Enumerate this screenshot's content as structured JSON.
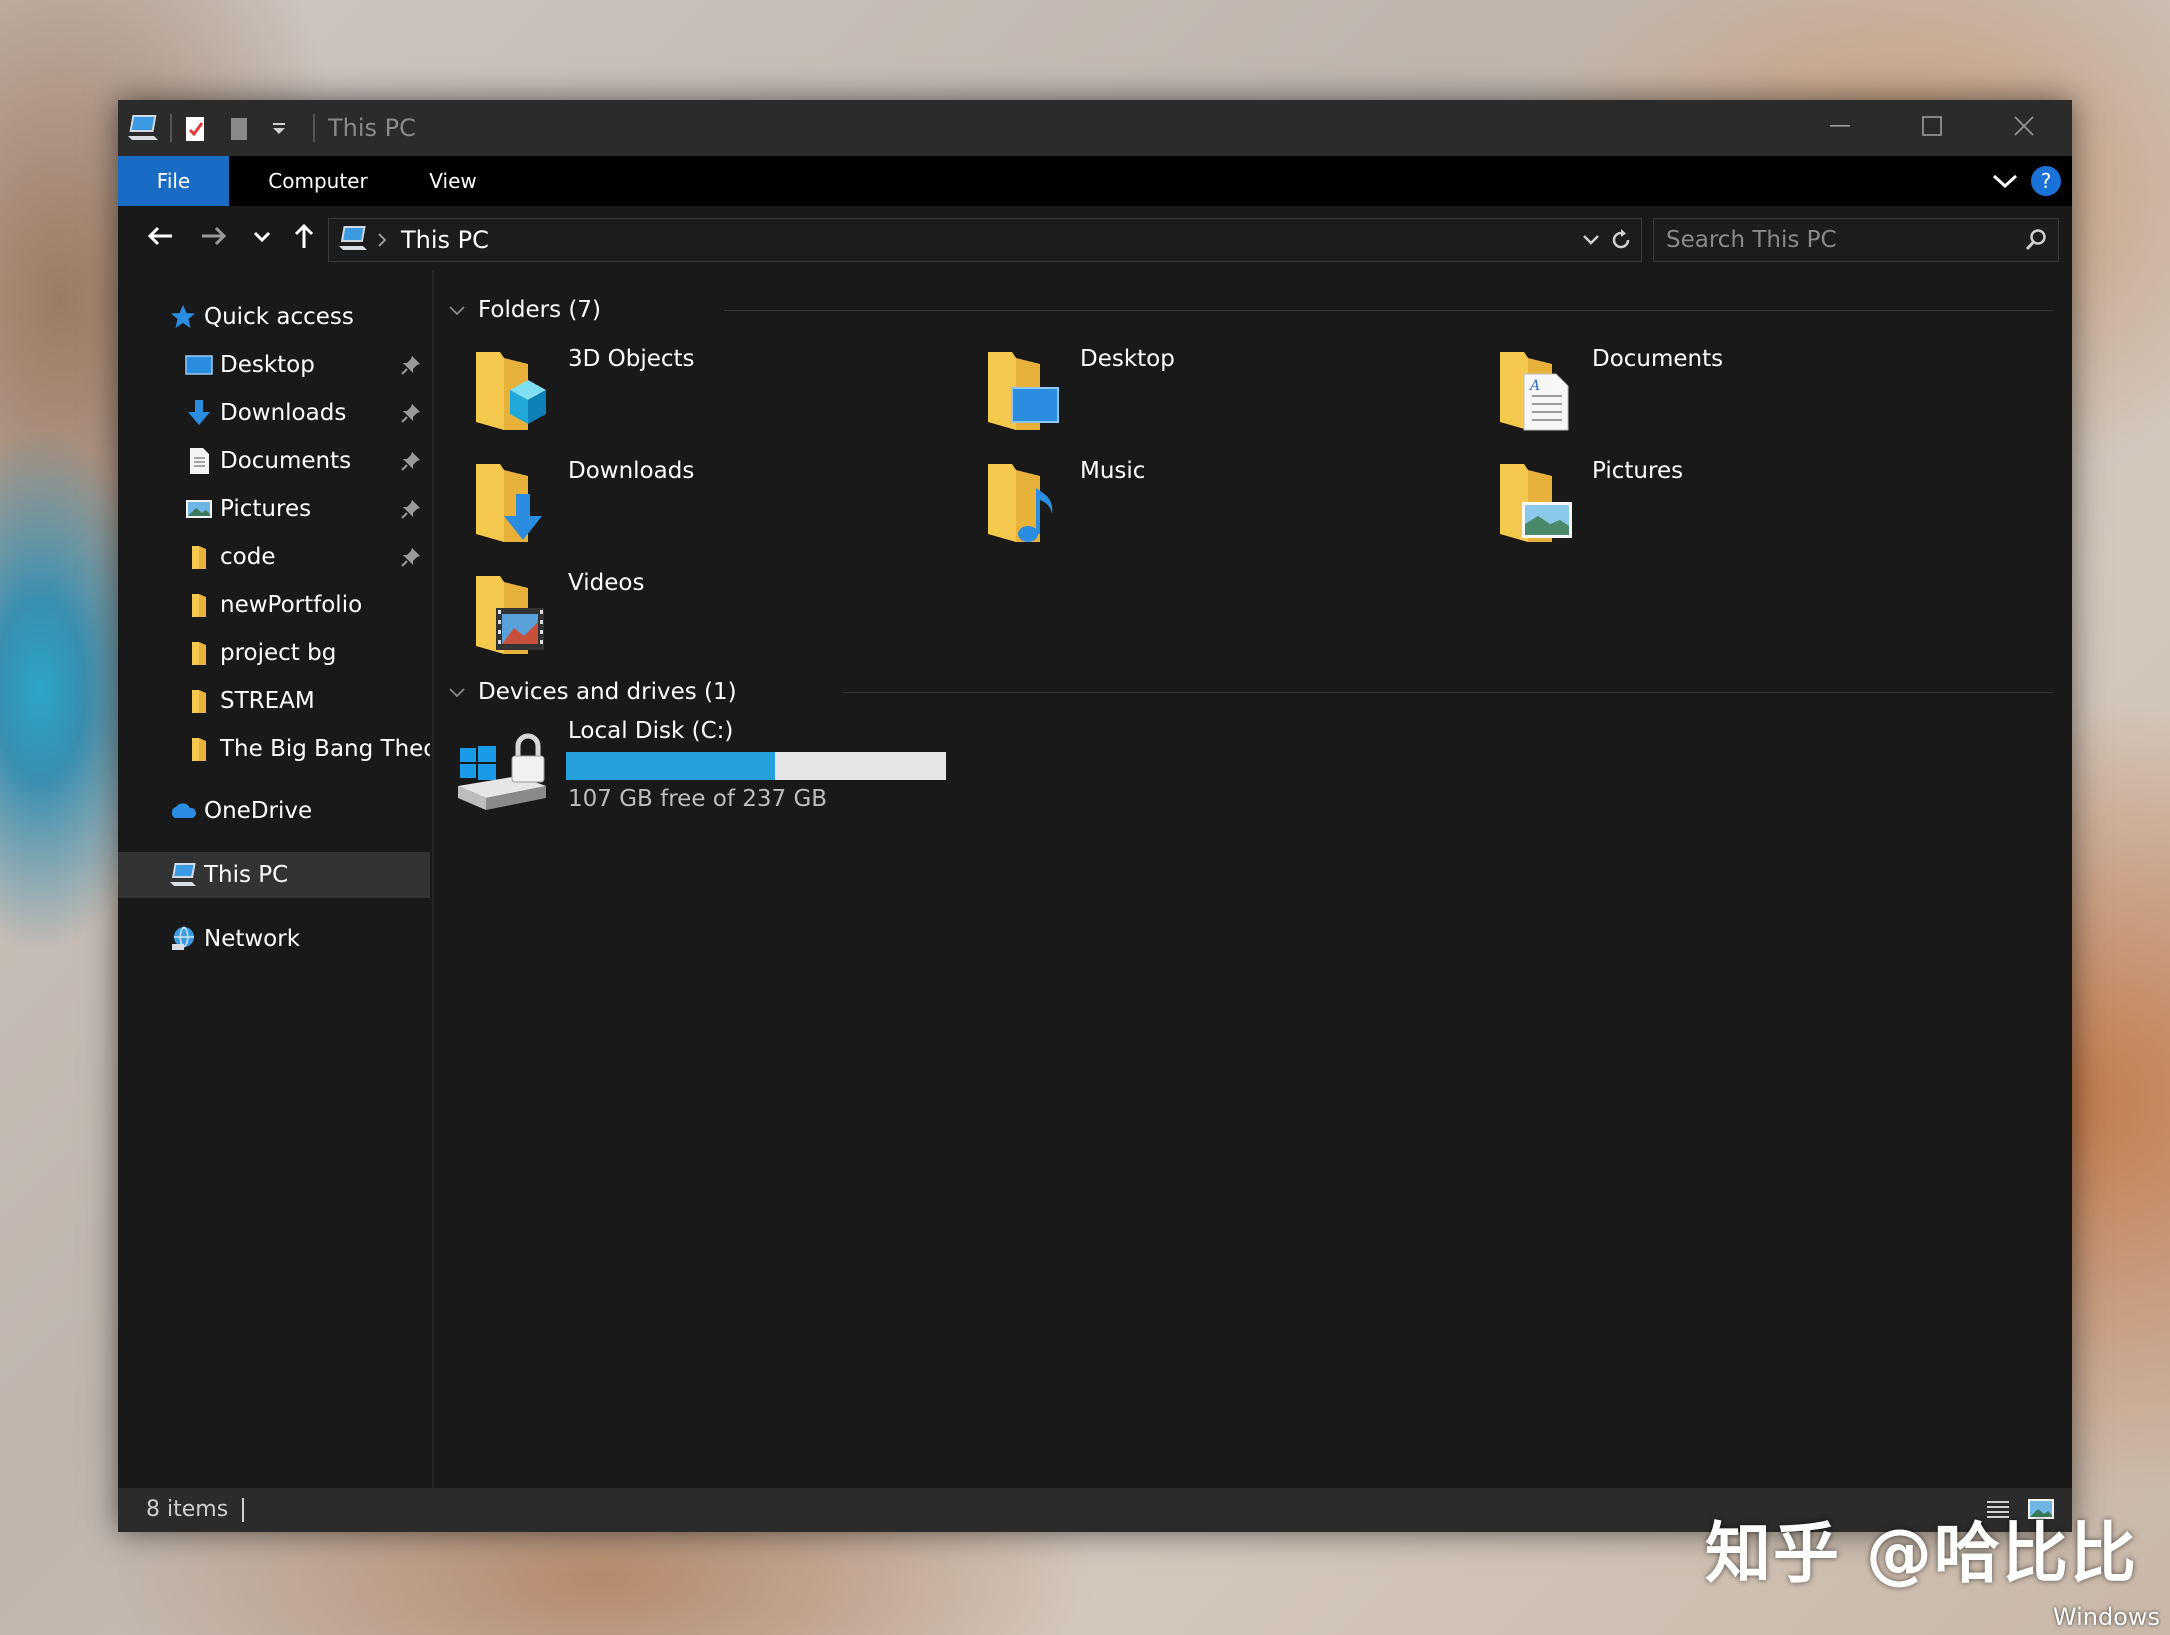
{
  "window": {
    "title": "This PC",
    "minimize_icon": "minimize-icon",
    "maximize_icon": "maximize-icon",
    "close_icon": "close-icon"
  },
  "ribbon": {
    "tabs": [
      "File",
      "Computer",
      "View"
    ],
    "help_label": "?"
  },
  "address": {
    "path": "This PC",
    "search_placeholder": "Search This PC"
  },
  "sidebar": {
    "items": [
      {
        "label": "Quick access",
        "icon": "star-icon"
      },
      {
        "label": "Desktop",
        "icon": "desktop-icon",
        "pinned": true
      },
      {
        "label": "Downloads",
        "icon": "download-arrow-icon",
        "pinned": true
      },
      {
        "label": "Documents",
        "icon": "document-icon",
        "pinned": true
      },
      {
        "label": "Pictures",
        "icon": "picture-icon",
        "pinned": true
      },
      {
        "label": "code",
        "icon": "folder-icon",
        "pinned": true
      },
      {
        "label": "newPortfolio",
        "icon": "folder-icon"
      },
      {
        "label": "project bg",
        "icon": "folder-icon"
      },
      {
        "label": "STREAM",
        "icon": "folder-icon"
      },
      {
        "label": "The Big Bang Theor",
        "icon": "folder-icon"
      },
      {
        "label": "OneDrive",
        "icon": "cloud-icon"
      },
      {
        "label": "This PC",
        "icon": "computer-icon",
        "selected": true
      },
      {
        "label": "Network",
        "icon": "network-icon"
      }
    ]
  },
  "groups": {
    "folders_title": "Folders (7)",
    "devices_title": "Devices and drives (1)"
  },
  "folders": [
    {
      "label": "3D Objects",
      "icon": "3d-objects-folder-icon"
    },
    {
      "label": "Desktop",
      "icon": "desktop-folder-icon"
    },
    {
      "label": "Documents",
      "icon": "documents-folder-icon"
    },
    {
      "label": "Downloads",
      "icon": "downloads-folder-icon"
    },
    {
      "label": "Music",
      "icon": "music-folder-icon"
    },
    {
      "label": "Pictures",
      "icon": "pictures-folder-icon"
    },
    {
      "label": "Videos",
      "icon": "videos-folder-icon"
    }
  ],
  "drive": {
    "label": "Local Disk (C:)",
    "free_text": "107 GB free of 237 GB",
    "used_fraction": 0.549,
    "icon": "windows-drive-lock-icon"
  },
  "status": {
    "item_count": "8 items"
  },
  "watermark": {
    "text": "知乎 @哈比比",
    "corner_text": "Windows"
  },
  "colors": {
    "accent": "#1a6bc4",
    "folder": "#f5c94e",
    "drive_bar": "#26a0da",
    "drive_bar_bg": "#e6e6e6"
  }
}
